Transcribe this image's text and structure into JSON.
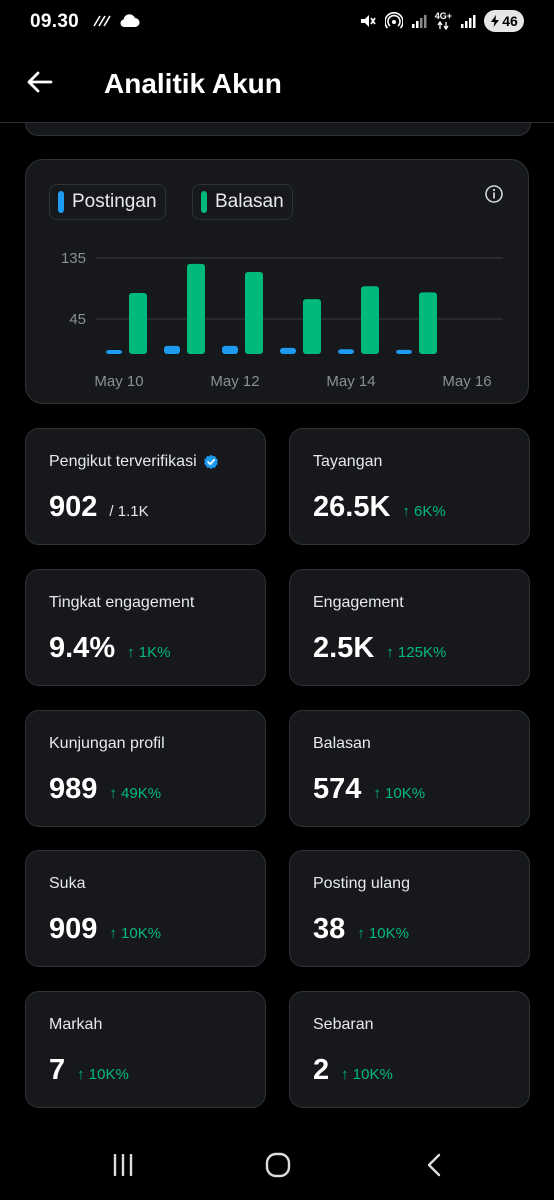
{
  "status_bar": {
    "time": "09.30",
    "network": "4G+",
    "battery": "46"
  },
  "header": {
    "title": "Analitik Akun"
  },
  "chart": {
    "legend": [
      {
        "label": "Postingan",
        "color": "#1d9bf0"
      },
      {
        "label": "Balasan",
        "color": "#00ba7c"
      }
    ]
  },
  "chart_data": {
    "type": "bar",
    "categories": [
      "May 10",
      "May 11",
      "May 12",
      "May 13",
      "May 14",
      "May 15"
    ],
    "x_tick_labels": [
      "May 10",
      "May 12",
      "May 14",
      "May 16"
    ],
    "y_tick_labels": [
      "135",
      "45"
    ],
    "y_ticks": [
      135,
      45
    ],
    "ylim": [
      0,
      150
    ],
    "series": [
      {
        "name": "Postingan",
        "color": "#1d9bf0",
        "values": [
          5,
          12,
          12,
          9,
          7,
          6
        ]
      },
      {
        "name": "Balasan",
        "color": "#00ba7c",
        "values": [
          90,
          133,
          121,
          81,
          100,
          91
        ]
      }
    ],
    "grid": true,
    "legend_position": "top-left"
  },
  "stats": [
    {
      "label": "Pengikut terverifikasi",
      "value": "902",
      "sub": "/ 1.1K",
      "delta": "",
      "verified_icon": true
    },
    {
      "label": "Tayangan",
      "value": "26.5K",
      "sub": "",
      "delta": "↑ 6K%"
    },
    {
      "label": "Tingkat engagement",
      "value": "9.4%",
      "sub": "",
      "delta": "↑ 1K%"
    },
    {
      "label": "Engagement",
      "value": "2.5K",
      "sub": "",
      "delta": "↑ 125K%"
    },
    {
      "label": "Kunjungan profil",
      "value": "989",
      "sub": "",
      "delta": "↑ 49K%"
    },
    {
      "label": "Balasan",
      "value": "574",
      "sub": "",
      "delta": "↑ 10K%"
    },
    {
      "label": "Suka",
      "value": "909",
      "sub": "",
      "delta": "↑ 10K%"
    },
    {
      "label": "Posting ulang",
      "value": "38",
      "sub": "",
      "delta": "↑ 10K%"
    },
    {
      "label": "Markah",
      "value": "7",
      "sub": "",
      "delta": "↑ 10K%"
    },
    {
      "label": "Sebaran",
      "value": "2",
      "sub": "",
      "delta": "↑ 10K%"
    }
  ]
}
